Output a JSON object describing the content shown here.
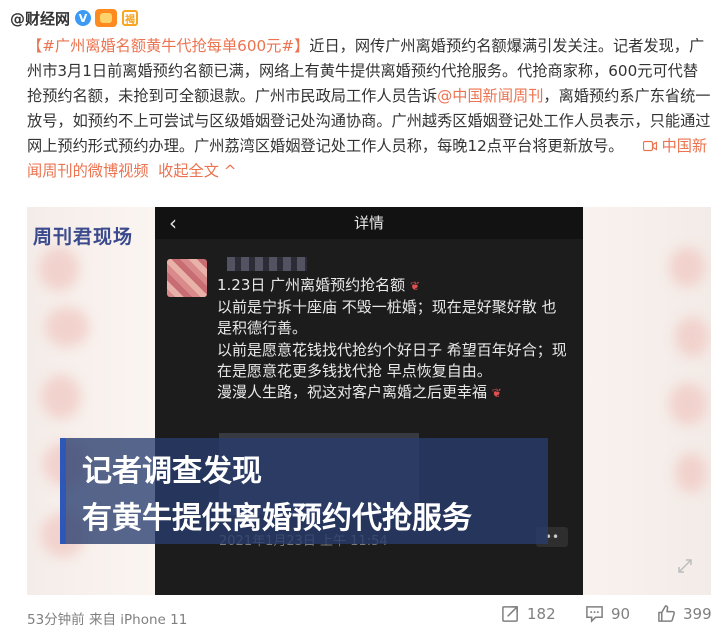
{
  "header": {
    "author": "@财经网",
    "verified_mark": "V",
    "badge_char": "褐"
  },
  "post": {
    "hashtag": "【#广州离婚名额黄牛代抢每单600元#】",
    "text_part1": "近日，网传广州离婚预约名额爆满引发关注。记者发现，广州市3月1日前离婚预约名额已满，网络上有黄牛提供离婚预约代抢服务。代抢商家称，600元可代替抢预约名额，未抢到可全额退款。广州市民政局工作人员告诉",
    "mention": "@中国新闻周刊",
    "text_part2": "，离婚预约系广东省统一放号，如预约不上可尝试与区级婚姻登记处沟通协商。广州越秀区婚姻登记处工作人员表示，只能通过网上预约形式预约办理。广州荔湾区婚姻登记处工作人员称，每晚12点平台将更新放号。",
    "video_link": "中国新闻周刊的微博视频",
    "collapse_label": "收起全文"
  },
  "media": {
    "logo": "周刊君现场",
    "phone_title": "详情",
    "moment_lines": [
      "1.23日 广州离婚预约抢名额",
      "以前是宁拆十座庙 不毁一桩婚；现在是好聚好散 也是积德行善。",
      "以前是愿意花钱找代抢约个好日子 希望百年好合；现在是愿意花更多钱找代抢 早点恢复自由。",
      "漫漫人生路，祝这对客户离婚之后更幸福"
    ],
    "timestamp": "2021年1月23日 上午 11:54",
    "dots": "••",
    "caption_line1": "记者调查发现",
    "caption_line2": "有黄牛提供离婚预约代抢服务"
  },
  "footer": {
    "meta": "53分钟前 来自 iPhone 11",
    "repost_count": "182",
    "comment_count": "90",
    "like_count": "399"
  },
  "colors": {
    "link": "#eb7350",
    "verified": "#3b9af5",
    "caption_bg": "#2f57b8"
  }
}
